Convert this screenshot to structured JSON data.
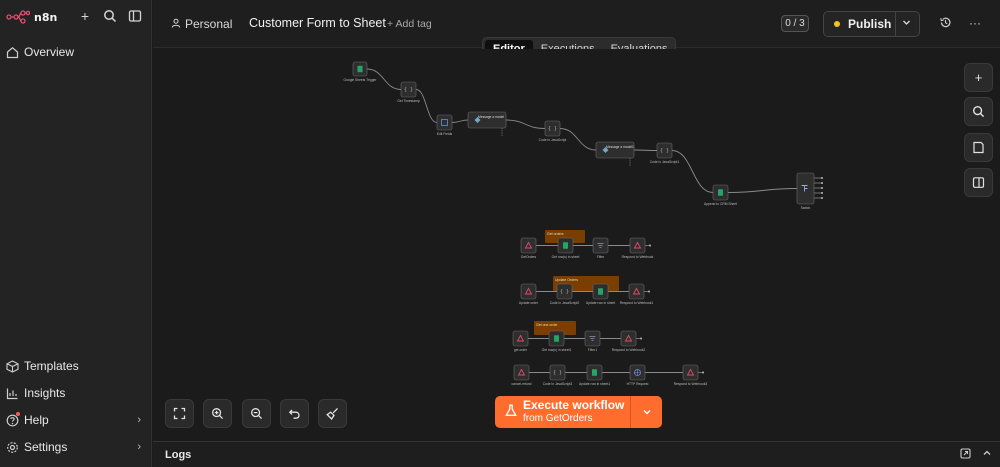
{
  "brand": {
    "name": "n8n"
  },
  "sidebar": {
    "overview": "Overview",
    "bottom_items": [
      {
        "label": "Templates",
        "icon": "box-icon"
      },
      {
        "label": "Insights",
        "icon": "chart-icon"
      },
      {
        "label": "Help",
        "icon": "help-icon"
      },
      {
        "label": "Settings",
        "icon": "gear-icon"
      }
    ]
  },
  "header": {
    "project": "Personal",
    "title": "Customer Form to Sheet",
    "add_tag": "+ Add tag",
    "counter": "0 / 3",
    "publish": "Publish"
  },
  "tabs": [
    "Editor",
    "Executions",
    "Evaluations"
  ],
  "execute": {
    "label": "Execute workflow",
    "sub": "from GetOrders"
  },
  "logs": {
    "label": "Logs"
  },
  "colors": {
    "accent": "#ff6d2e",
    "publish_dot": "#f5c518",
    "sticky": "#7a3f00"
  },
  "nodes": [
    {
      "label": "Google Sheets Trigger",
      "sub": "",
      "kind": "sheets"
    },
    {
      "label": "Get Timestamp",
      "sub": "",
      "kind": "code"
    },
    {
      "label": "Edit Fields",
      "sub": "",
      "kind": "set"
    },
    {
      "label": "Message a model",
      "sub": "",
      "kind": "ai"
    },
    {
      "label": "Code in JavaScript",
      "sub": "",
      "kind": "code"
    },
    {
      "label": "Message a model1",
      "sub": "",
      "kind": "ai"
    },
    {
      "label": "Code in JavaScript1",
      "sub": "",
      "kind": "code"
    },
    {
      "label": "Append to CRM Sheet",
      "sub": "",
      "kind": "sheets"
    },
    {
      "label": "Switch",
      "sub": "",
      "kind": "switch"
    },
    {
      "label": "GetOrders",
      "sub": "",
      "kind": "webhook"
    },
    {
      "label": "Get row(s) in sheet",
      "sub": "",
      "kind": "sheets"
    },
    {
      "label": "Filter",
      "sub": "",
      "kind": "filter"
    },
    {
      "label": "Respond to Webhook",
      "sub": "",
      "kind": "webhook"
    },
    {
      "label": "Update order",
      "sub": "",
      "kind": "webhook"
    },
    {
      "label": "Code in JavaScript2",
      "sub": "",
      "kind": "code"
    },
    {
      "label": "Update row in sheet",
      "sub": "",
      "kind": "sheets"
    },
    {
      "label": "Respond to Webhook1",
      "sub": "",
      "kind": "webhook"
    },
    {
      "label": "get order",
      "sub": "",
      "kind": "webhook"
    },
    {
      "label": "Get row(s) in sheet1",
      "sub": "",
      "kind": "sheets"
    },
    {
      "label": "Filter1",
      "sub": "",
      "kind": "filter"
    },
    {
      "label": "Respond to Webhook2",
      "sub": "",
      "kind": "webhook"
    },
    {
      "label": "cancel-refund",
      "sub": "",
      "kind": "webhook"
    },
    {
      "label": "Code in JavaScript3",
      "sub": "",
      "kind": "code"
    },
    {
      "label": "Update row in sheet1",
      "sub": "",
      "kind": "sheets"
    },
    {
      "label": "HTTP Request",
      "sub": "",
      "kind": "http"
    },
    {
      "label": "Respond to Webhook3",
      "sub": "",
      "kind": "webhook"
    }
  ],
  "stickies": [
    "Get orders",
    "Update Orders",
    "Get one order"
  ]
}
